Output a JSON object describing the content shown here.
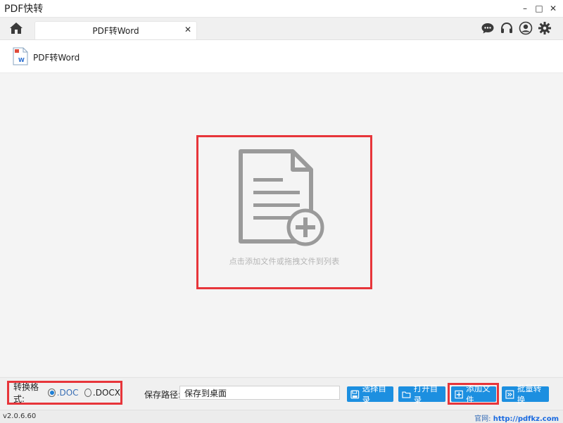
{
  "window": {
    "title": "PDF快转",
    "minimize": "–",
    "maximize": "□",
    "close": "✕"
  },
  "tab": {
    "label": "PDF转Word",
    "close": "✕"
  },
  "header_icons": [
    "chat-icon",
    "headset-icon",
    "user-icon",
    "gear-icon"
  ],
  "page": {
    "title": "PDF转Word"
  },
  "dropzone": {
    "hint": "点击添加文件或拖拽文件到列表"
  },
  "format": {
    "label": "转换格式:",
    "options": [
      {
        "label": ".DOC",
        "selected": true
      },
      {
        "label": ".DOCX",
        "selected": false
      }
    ]
  },
  "save": {
    "label": "保存路径:",
    "value": "保存到桌面"
  },
  "buttons": {
    "choose_dir": "选择目录",
    "open_dir": "打开目录",
    "add_file": "添加文件",
    "batch_convert": "批量转换"
  },
  "status": {
    "version": "v2.0.6.60",
    "site_label": "官网:",
    "site_url": "http://pdfkz.com"
  },
  "colors": {
    "accent": "#1c8fe0",
    "highlight": "#e7353a"
  }
}
